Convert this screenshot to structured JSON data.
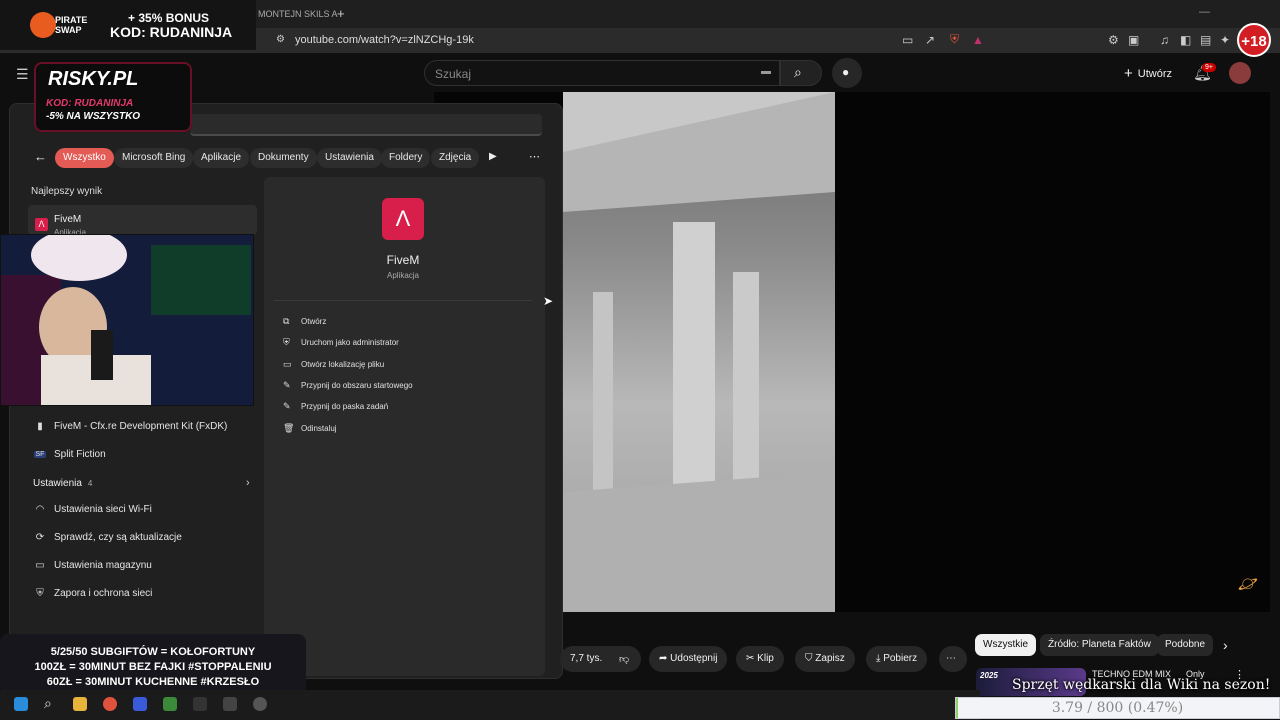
{
  "browser": {
    "tab_title": "MONTEJN SKILS A",
    "url": "youtube.com/watch?v=zlNZCHg-19k"
  },
  "youtube": {
    "search_placeholder": "Szukaj",
    "create_label": "Utwórz",
    "notif_count": "9+",
    "likes": "7,7 tys.",
    "share": "Udostępnij",
    "clip": "Klip",
    "save": "Zapisz",
    "download": "Pobierz",
    "chips": [
      "Wszystkie",
      "Źródło: Planeta Faktów",
      "Podobne"
    ],
    "side_video": {
      "title": "TECHNO EDM MIX",
      "badge_text": "Only",
      "thumb_year": "2025"
    }
  },
  "start_menu": {
    "filters": [
      "Wszystko",
      "Microsoft Bing",
      "Aplikacje",
      "Dokumenty",
      "Ustawienia",
      "Foldery",
      "Zdjęcia"
    ],
    "best_match_title": "Najlepszy wynik",
    "best_match": {
      "name": "FiveM",
      "type": "Aplikacja"
    },
    "apps": [
      {
        "label": "FiveM - Cfx.re Development Kit (FxDK)",
        "icon": "document-icon"
      },
      {
        "label": "Split Fiction",
        "icon": "sf-icon"
      }
    ],
    "settings_title": "Ustawienia",
    "settings_count": "4",
    "settings": [
      {
        "label": "Ustawienia sieci Wi-Fi",
        "icon": "wifi-icon"
      },
      {
        "label": "Sprawdź, czy są aktualizacje",
        "icon": "sync-icon"
      },
      {
        "label": "Ustawienia magazynu",
        "icon": "storage-icon"
      },
      {
        "label": "Zapora i ochrona sieci",
        "icon": "shield-icon"
      }
    ],
    "detail": {
      "app_name": "FiveM",
      "app_type": "Aplikacja",
      "actions": [
        {
          "label": "Otwórz",
          "icon": "open-icon"
        },
        {
          "label": "Uruchom jako administrator",
          "icon": "admin-icon"
        },
        {
          "label": "Otwórz lokalizację pliku",
          "icon": "folder-icon"
        },
        {
          "label": "Przypnij do obszaru startowego",
          "icon": "pin-icon"
        },
        {
          "label": "Przypnij do paska zadań",
          "icon": "pin-icon"
        },
        {
          "label": "Odinstaluj",
          "icon": "trash-icon"
        }
      ]
    }
  },
  "overlays": {
    "piratebonus": "+ 35% BONUS",
    "piratecode": "KOD: RUDANINJA",
    "piratebrand": "PIRATE SWAP",
    "risky_brand": "RISKY.PL",
    "risky_code": "KOD: RUDANINJA",
    "risky_offer": "-5% NA WSZYSTKO",
    "age_badge": "+18",
    "bottom_lines": [
      "5/25/50 SUBGIFTÓW = KOŁOFORTUNY",
      "100ZŁ = 30MINUT BEZ FAJKI #STOPPALENIU",
      "60ZŁ = 30MINUT KUCHENNE #KRZESŁO"
    ],
    "caption": "Sprzęt wędkarski dla Wiki na sezon!",
    "progress": "3.79 / 800 (0.47%)",
    "progress_fraction": 0.0047
  },
  "colors": {
    "accent_pill": "#e45b55",
    "fivem_icon": "#d81e4a",
    "badge_red": "#d21d22"
  }
}
